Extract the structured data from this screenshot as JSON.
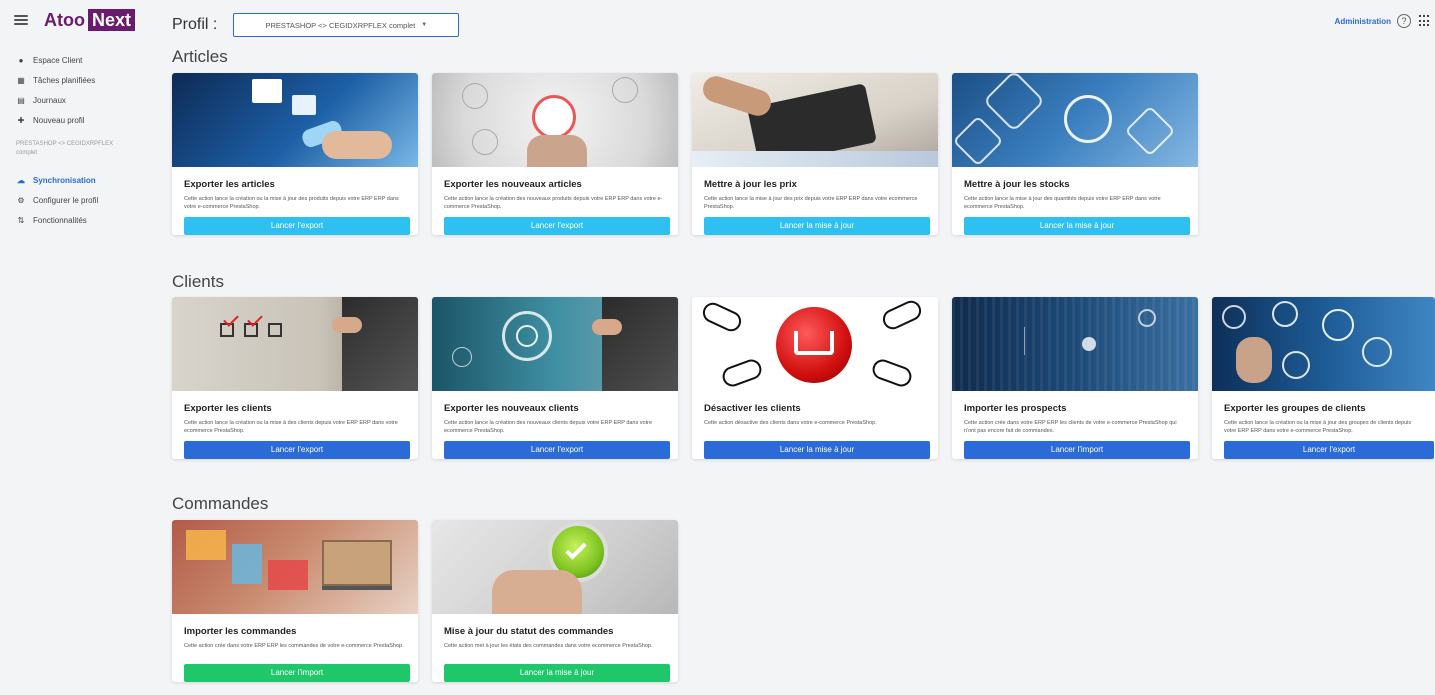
{
  "sidebar": {
    "logo_atoo": "Atoo",
    "logo_next": "Next",
    "items": [
      {
        "label": "Espace Client",
        "icon": "info-icon"
      },
      {
        "label": "Tâches planifiées",
        "icon": "calendar-icon"
      },
      {
        "label": "Journaux",
        "icon": "logs-icon"
      },
      {
        "label": "Nouveau profil",
        "icon": "plus-icon"
      }
    ],
    "profile_label": "PRESTASHOP <> CEGIDXRPFLEX complet",
    "profile_items": [
      {
        "label": "Synchronisation",
        "icon": "cloud-icon",
        "active": true
      },
      {
        "label": "Configurer le profil",
        "icon": "gears-icon"
      },
      {
        "label": "Fonctionnalités",
        "icon": "sort-icon"
      }
    ]
  },
  "header": {
    "title": "Profil :",
    "profile_select": "PRESTASHOP <> CEGIDXRPFLEX complet",
    "admin_link": "Administration",
    "help_glyph": "?"
  },
  "sections": [
    {
      "title": "Articles",
      "cards": [
        {
          "title": "Exporter les articles",
          "desc": "Cette action lance la création ou la mise à jour des produits depuis votre ERP ERP dans votre e-commerce PrestaShop.",
          "button": "Lancer l'export",
          "btn_color": "cyan"
        },
        {
          "title": "Exporter les nouveaux articles",
          "desc": "Cette action lance la création des nouveaux produits depuis votre ERP ERP dans votre e-commerce PrestaShop.",
          "button": "Lancer l'export",
          "btn_color": "cyan"
        },
        {
          "title": "Mettre à jour les prix",
          "desc": "Cette action lance la mise à jour des prix depuis votre ERP ERP dans votre ecommerce PrestaShop.",
          "button": "Lancer la mise à jour",
          "btn_color": "cyan"
        },
        {
          "title": "Mettre à jour les stocks",
          "desc": "Cette action lance la mise à jour des quantités depuis votre ERP ERP dans votre ecommerce PrestaShop.",
          "button": "Lancer la mise à jour",
          "btn_color": "cyan"
        }
      ]
    },
    {
      "title": "Clients",
      "cards": [
        {
          "title": "Exporter les clients",
          "desc": "Cette action lance la création ou la mise à des clients depuis votre ERP ERP dans votre ecommerce PrestaShop.",
          "button": "Lancer l'export",
          "btn_color": "blue"
        },
        {
          "title": "Exporter les nouveaux clients",
          "desc": "Cette action lance la création des nouveaux clients depuis votre ERP ERP dans votre ecommerce PrestaShop.",
          "button": "Lancer l'export",
          "btn_color": "blue"
        },
        {
          "title": "Désactiver les clients",
          "desc": "Cette action désactive des clients dans votre e-commerce PrestaShop.",
          "button": "Lancer la mise à jour",
          "btn_color": "blue"
        },
        {
          "title": "Importer les prospects",
          "desc": "Cette action crée dans votre ERP ERP les clients de votre e-commerce PrestaShop qui n'ont pas encore fait de commandes.",
          "button": "Lancer l'import",
          "btn_color": "blue"
        },
        {
          "title": "Exporter les groupes de clients",
          "desc": "Cette action lance la création ou la mise à jour des groupes de clients depuis votre ERP ERP dans votre e-commerce PrestaShop.",
          "button": "Lancer l'export",
          "btn_color": "blue"
        }
      ]
    },
    {
      "title": "Commandes",
      "cards": [
        {
          "title": "Importer les commandes",
          "desc": "Cette action crée dans votre ERP ERP les commandes de votre e-commerce PrestaShop.",
          "button": "Lancer l'import",
          "btn_color": "green"
        },
        {
          "title": "Mise à jour du statut des commandes",
          "desc": "Cette action met à jour les états des commandes dans votre ecommerce PrestaShop.",
          "button": "Lancer la mise à jour",
          "btn_color": "green"
        }
      ]
    }
  ],
  "colors": {
    "brand": "#6a1b6e",
    "accent": "#2a6bd8",
    "cyan_button": "#2ec0f0",
    "blue_button": "#2a6bd8",
    "green_button": "#1fc66a"
  }
}
